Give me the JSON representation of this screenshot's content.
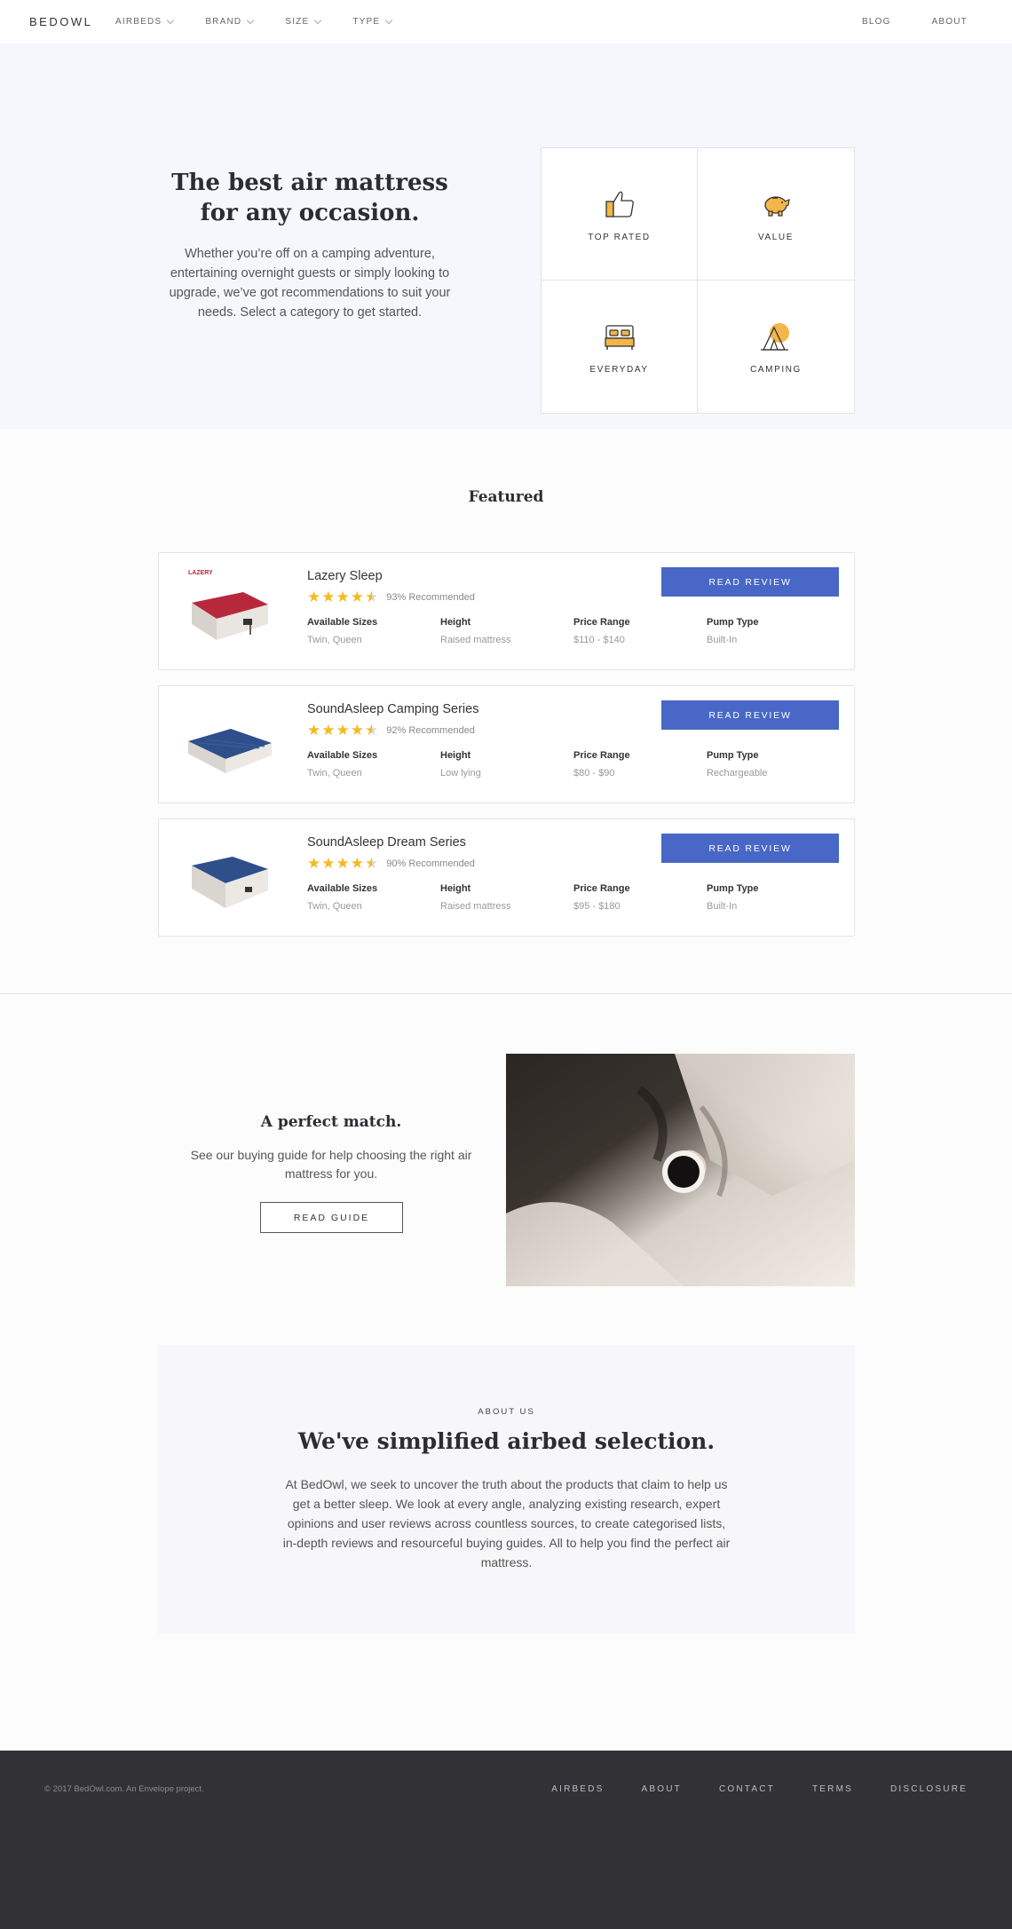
{
  "nav": {
    "logo": "BEDOWL",
    "menu": [
      "AIRBEDS",
      "BRAND",
      "SIZE",
      "TYPE"
    ],
    "right": [
      "BLOG",
      "ABOUT"
    ]
  },
  "hero": {
    "title": "The best air mattress for any occasion.",
    "text": "Whether you’re off on a camping adventure, entertaining overnight guests or simply looking to upgrade, we’ve got recommendations to suit your needs. Select a category to get started.",
    "categories": [
      {
        "label": "TOP RATED",
        "icon": "thumbs-up-icon"
      },
      {
        "label": "VALUE",
        "icon": "piggy-bank-icon"
      },
      {
        "label": "EVERYDAY",
        "icon": "bed-icon"
      },
      {
        "label": "CAMPING",
        "icon": "tent-icon"
      }
    ]
  },
  "featured": {
    "title": "Featured",
    "button_label": "READ REVIEW",
    "attr_labels": [
      "Available Sizes",
      "Height",
      "Price Range",
      "Pump Type"
    ],
    "products": [
      {
        "name": "Lazery Sleep",
        "rating": 4.5,
        "recommended": "93% Recommended",
        "sizes": "Twin, Queen",
        "height": "Raised mattress",
        "price": "$110 - $140",
        "pump": "Built-In",
        "color": "#b8283c"
      },
      {
        "name": "SoundAsleep Camping Series",
        "rating": 4.5,
        "recommended": "92% Recommended",
        "sizes": "Twin, Queen",
        "height": "Low lying",
        "price": "$80 - $90",
        "pump": "Rechargeable",
        "color": "#2e4f8a"
      },
      {
        "name": "SoundAsleep Dream Series",
        "rating": 4.5,
        "recommended": "90% Recommended",
        "sizes": "Twin, Queen",
        "height": "Raised mattress",
        "price": "$95 - $180",
        "pump": "Built-In",
        "color": "#2e4f8a"
      }
    ]
  },
  "match": {
    "title": "A perfect match.",
    "text": "See our buying guide for help choosing the right air mattress for you.",
    "button_label": "READ GUIDE"
  },
  "about": {
    "kicker": "ABOUT US",
    "title": "We've simplified airbed selection.",
    "text": "At BedOwl, we seek to uncover the truth about the products that claim to help us get a better sleep. We look at every angle, analyzing existing research, expert opinions and user reviews across countless sources, to create categorised lists, in-depth reviews and resourceful buying guides. All to help you find the perfect air mattress."
  },
  "footer": {
    "copyright": "© 2017 BedOwl.com. An Envelope project.",
    "links": [
      "AIRBEDS",
      "ABOUT",
      "CONTACT",
      "TERMS",
      "DISCLOSURE"
    ]
  },
  "colors": {
    "accent": "#4867c6",
    "star": "#f5b921",
    "footer_bg": "#323236",
    "hero_bg": "#f6f7fc"
  }
}
